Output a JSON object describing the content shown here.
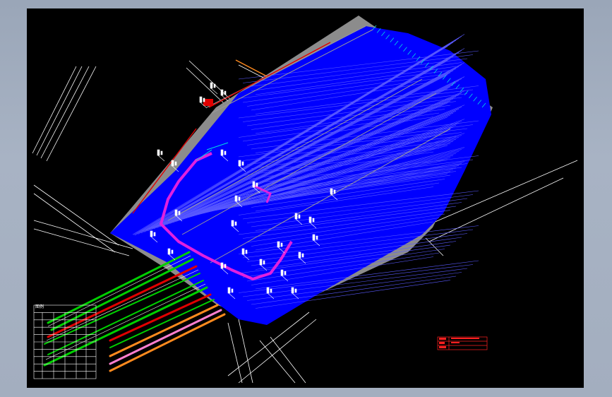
{
  "viewer": {
    "background": "#a3aebf",
    "canvas_color": "#000000"
  },
  "drawing": {
    "description_colors": {
      "structure_blue": "#0000ff",
      "slab_gray": "#8c8c8c",
      "pipe_green": "#00d000",
      "pipe_red": "#e00000",
      "pipe_orange": "#ff8a1e",
      "pipe_pink": "#ff7fd0",
      "pipe_magenta": "#e020e0",
      "edge_cyan": "#00e0e0",
      "linework_white": "#ffffff"
    }
  },
  "legend_table": {
    "title": "图例",
    "rows": 10,
    "cols": 6
  },
  "title_block": {
    "name": "title-block",
    "rows": 3
  }
}
